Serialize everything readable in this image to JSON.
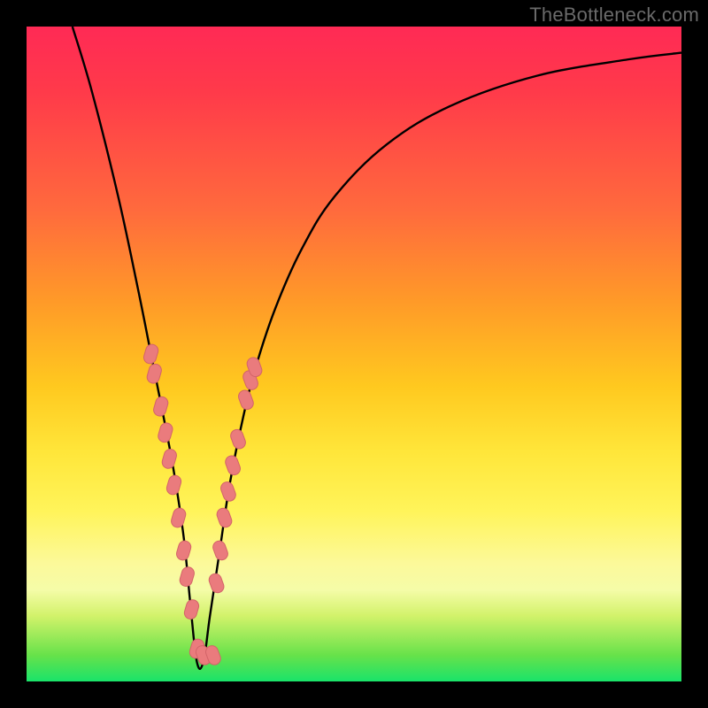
{
  "watermark": {
    "text": "TheBottleneck.com"
  },
  "colors": {
    "curve": "#000000",
    "marker_fill": "#ea7b7d",
    "marker_stroke": "#d36468",
    "frame_bg": "#000000"
  },
  "chart_data": {
    "type": "line",
    "title": "",
    "xlabel": "",
    "ylabel": "",
    "xlim": [
      0,
      100
    ],
    "ylim": [
      0,
      100
    ],
    "grid": false,
    "legend": false,
    "note": "x-axis is normalized 0–100 (no tick labels shown); y-axis shows bottleneck percentage 0–100. Minimum ≈0 at x≈26.",
    "series": [
      {
        "name": "bottleneck-curve",
        "x": [
          7,
          10,
          14,
          17,
          19,
          21,
          22.5,
          24,
          25,
          26,
          27,
          28,
          29.5,
          31,
          33,
          35,
          38,
          42,
          47,
          55,
          65,
          78,
          92,
          100
        ],
        "y": [
          100,
          90,
          74,
          60,
          50,
          40,
          32,
          22,
          12,
          3,
          3,
          10,
          20,
          30,
          40,
          48,
          57,
          66,
          74,
          82,
          88,
          92.5,
          95,
          96
        ]
      }
    ],
    "markers": {
      "name": "highlighted-points",
      "description": "Pink rounded markers overlaid on the curve near the trough region.",
      "points": [
        {
          "x": 19.0,
          "y": 50
        },
        {
          "x": 19.5,
          "y": 47
        },
        {
          "x": 20.5,
          "y": 42
        },
        {
          "x": 21.2,
          "y": 38
        },
        {
          "x": 21.8,
          "y": 34
        },
        {
          "x": 22.5,
          "y": 30
        },
        {
          "x": 23.2,
          "y": 25
        },
        {
          "x": 24.0,
          "y": 20
        },
        {
          "x": 24.5,
          "y": 16
        },
        {
          "x": 25.2,
          "y": 11
        },
        {
          "x": 26.0,
          "y": 5
        },
        {
          "x": 27.0,
          "y": 4
        },
        {
          "x": 28.5,
          "y": 4
        },
        {
          "x": 29.0,
          "y": 15
        },
        {
          "x": 29.6,
          "y": 20
        },
        {
          "x": 30.2,
          "y": 25
        },
        {
          "x": 30.8,
          "y": 29
        },
        {
          "x": 31.5,
          "y": 33
        },
        {
          "x": 32.3,
          "y": 37
        },
        {
          "x": 33.5,
          "y": 43
        },
        {
          "x": 34.2,
          "y": 46
        },
        {
          "x": 34.8,
          "y": 48
        }
      ]
    }
  }
}
